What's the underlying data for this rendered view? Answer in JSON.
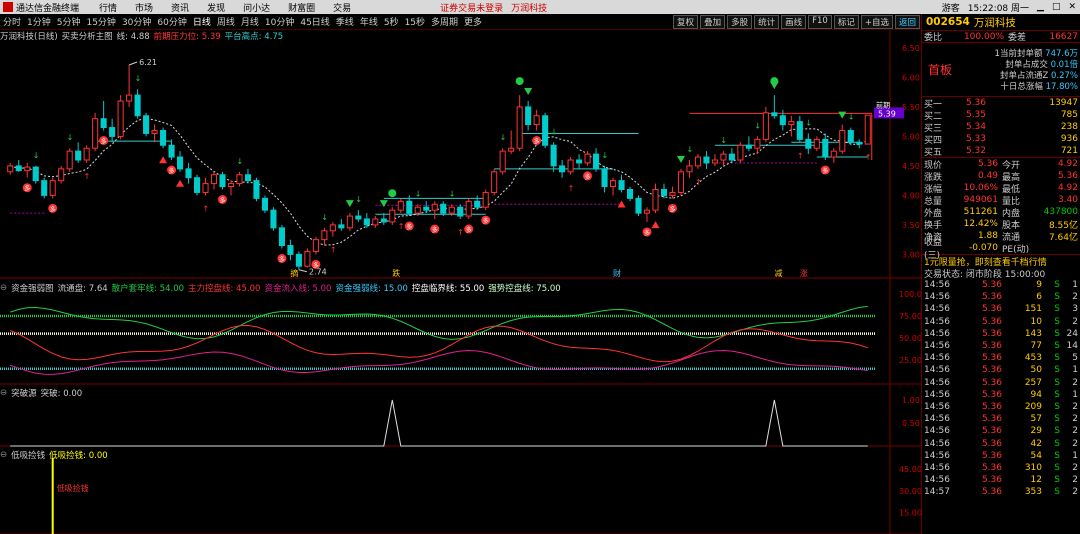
{
  "titlebar": {
    "app": "通达信金融终端",
    "menu": [
      "行情",
      "市场",
      "资讯",
      "发现",
      "问小达",
      "财富圈",
      "交易"
    ],
    "login": "证券交易未登录",
    "stock": "万润科技",
    "time": "15:22:08 周一",
    "misc": [
      "游客"
    ]
  },
  "periods": [
    "分时",
    "1分钟",
    "5分钟",
    "15分钟",
    "30分钟",
    "60分钟",
    "日线",
    "周线",
    "月线",
    "10分钟",
    "45日线",
    "季线",
    "年线",
    "5秒",
    "15秒",
    "多周期",
    "更多"
  ],
  "active_period": "日线",
  "toolbar": [
    "复权",
    "叠加",
    "多股",
    "统计",
    "画线",
    "F10",
    "标记",
    "+自选",
    "返回"
  ],
  "main_header": {
    "name": "万润科技(日线)",
    "formula": "买卖分析主图",
    "params": "线: 4.88",
    "resist_label": "前期压力位: 5.39",
    "plat_label": "平台高点: 4.75"
  },
  "main_axis": [
    "6.50",
    "6.00",
    "5.50",
    "5.00",
    "4.50",
    "4.00",
    "3.50",
    "3.00"
  ],
  "price_tag": "5.39",
  "price_tag_suffix": "前期",
  "annot": {
    "high": "6.21",
    "low": "2.74"
  },
  "event_labels": [
    "摘",
    "跌",
    "财",
    "减",
    "涨"
  ],
  "ind1_header": {
    "name": "资金强弱图",
    "items": [
      "流通盘: 7.64",
      "散户套牢线: 54.00",
      "主力控盘线: 45.00",
      "资金流入线: 5.00",
      "资金强弱线: 15.00",
      "控盘临界线: 55.00",
      "强势控盘线: 75.00"
    ]
  },
  "ind1_axis": [
    "100.0",
    "75.00",
    "50.00",
    "25.00"
  ],
  "ind2_header": {
    "name": "突破源",
    "items": [
      "突破: 0.00"
    ]
  },
  "ind2_axis": [
    "1.00",
    "0.50"
  ],
  "ind3_header": {
    "name": "低吸捡钱",
    "items": [
      "低吸捡钱: 0.00"
    ]
  },
  "ind3_axis": [
    "45.00",
    "30.00",
    "15.00"
  ],
  "ind3_label": "低吸捡钱",
  "quote": {
    "code": "002654",
    "name": "万润科技",
    "weibi_l": "委比",
    "weibi": "100.00%",
    "weicha_l": "委差",
    "weicha": "16627",
    "seal": [
      [
        "1当前封单额",
        "747.6万"
      ],
      [
        "封单占成交",
        "0.01倍"
      ],
      [
        "封单占流通Z",
        "0.27%"
      ],
      [
        "十日总涨幅",
        "17.80%"
      ]
    ],
    "board": "首板",
    "sell": [
      [
        "卖五",
        "5.40",
        ""
      ],
      [
        "卖四",
        "5.39",
        ""
      ],
      [
        "卖三",
        "5.38",
        ""
      ],
      [
        "卖二",
        "5.37",
        ""
      ],
      [
        "卖一",
        "5.36",
        ""
      ]
    ],
    "buy": [
      [
        "买一",
        "5.36",
        "13947"
      ],
      [
        "买二",
        "5.35",
        "785"
      ],
      [
        "买三",
        "5.34",
        "238"
      ],
      [
        "买四",
        "5.33",
        "936"
      ],
      [
        "买五",
        "5.32",
        "721"
      ]
    ],
    "stats": [
      [
        "现价",
        "5.36",
        "今开",
        "4.92"
      ],
      [
        "涨跌",
        "0.49",
        "最高",
        "5.36"
      ],
      [
        "涨幅",
        "10.06%",
        "最低",
        "4.92"
      ],
      [
        "总量",
        "949061",
        "量比",
        "3.40"
      ],
      [
        "外盘",
        "511261",
        "内盘",
        "437800"
      ],
      [
        "换手",
        "12.42%",
        "股本",
        "8.55亿"
      ],
      [
        "净资",
        "1.88",
        "流通",
        "7.64亿"
      ],
      [
        "收益(三)",
        "-0.070",
        "PE(动)",
        ""
      ]
    ],
    "promo": "1元限量抢，即刻查看千档行情",
    "status": "交易状态: 闭市阶段 15:00:00",
    "ticks": [
      [
        "14:56",
        "5.36",
        "9",
        "S",
        "1"
      ],
      [
        "14:56",
        "5.36",
        "6",
        "S",
        "2"
      ],
      [
        "14:56",
        "5.36",
        "151",
        "S",
        "3"
      ],
      [
        "14:56",
        "5.36",
        "10",
        "S",
        "2"
      ],
      [
        "14:56",
        "5.36",
        "143",
        "S",
        "24"
      ],
      [
        "14:56",
        "5.36",
        "77",
        "S",
        "14"
      ],
      [
        "14:56",
        "5.36",
        "453",
        "S",
        "5"
      ],
      [
        "14:56",
        "5.36",
        "50",
        "S",
        "1"
      ],
      [
        "14:56",
        "5.36",
        "257",
        "S",
        "2"
      ],
      [
        "14:56",
        "5.36",
        "94",
        "S",
        "1"
      ],
      [
        "14:56",
        "5.36",
        "209",
        "S",
        "2"
      ],
      [
        "14:56",
        "5.36",
        "57",
        "S",
        "2"
      ],
      [
        "14:56",
        "5.36",
        "29",
        "S",
        "2"
      ],
      [
        "14:56",
        "5.36",
        "42",
        "S",
        "2"
      ],
      [
        "14:56",
        "5.36",
        "54",
        "S",
        "1"
      ],
      [
        "14:56",
        "5.36",
        "310",
        "S",
        "2"
      ],
      [
        "14:56",
        "5.36",
        "12",
        "S",
        "2"
      ],
      [
        "14:57",
        "5.36",
        "353",
        "S",
        "2"
      ]
    ]
  },
  "colors": {
    "up": "#ff3333",
    "down": "#00cccc",
    "wave": "#dddddd",
    "resist": "#ff3333",
    "plat": "#33cccc",
    "green": "#22cc44",
    "magenta": "#e0208f",
    "yellow": "#ffff00"
  },
  "chart_data": {
    "type": "candlestick",
    "price_range": [
      2.6,
      6.6
    ],
    "candles": [
      [
        4.4,
        4.55,
        4.35,
        4.5
      ],
      [
        4.5,
        4.6,
        4.4,
        4.42
      ],
      [
        4.42,
        4.55,
        4.3,
        4.48
      ],
      [
        4.48,
        4.5,
        4.2,
        4.25
      ],
      [
        4.25,
        4.3,
        3.95,
        4.0
      ],
      [
        4.0,
        4.3,
        3.95,
        4.25
      ],
      [
        4.25,
        4.5,
        4.2,
        4.45
      ],
      [
        4.45,
        4.8,
        4.4,
        4.75
      ],
      [
        4.75,
        4.9,
        4.55,
        4.6
      ],
      [
        4.6,
        4.85,
        4.55,
        4.8
      ],
      [
        4.8,
        5.4,
        4.75,
        5.3
      ],
      [
        5.3,
        5.6,
        5.1,
        5.15
      ],
      [
        5.15,
        5.3,
        4.9,
        5.0
      ],
      [
        5.0,
        5.7,
        4.95,
        5.6
      ],
      [
        5.6,
        6.21,
        5.5,
        5.7
      ],
      [
        5.7,
        5.8,
        5.3,
        5.35
      ],
      [
        5.35,
        5.4,
        5.0,
        5.05
      ],
      [
        5.05,
        5.2,
        4.9,
        5.1
      ],
      [
        5.1,
        5.15,
        4.8,
        4.85
      ],
      [
        4.85,
        4.95,
        4.6,
        4.65
      ],
      [
        4.65,
        4.75,
        4.4,
        4.45
      ],
      [
        4.45,
        4.55,
        4.2,
        4.3
      ],
      [
        4.3,
        4.35,
        4.0,
        4.05
      ],
      [
        4.05,
        4.3,
        4.0,
        4.2
      ],
      [
        4.2,
        4.4,
        4.1,
        4.35
      ],
      [
        4.35,
        4.4,
        4.1,
        4.15
      ],
      [
        4.15,
        4.25,
        4.0,
        4.2
      ],
      [
        4.2,
        4.4,
        4.15,
        4.35
      ],
      [
        4.35,
        4.45,
        4.2,
        4.25
      ],
      [
        4.25,
        4.3,
        3.9,
        3.95
      ],
      [
        3.95,
        4.0,
        3.7,
        3.75
      ],
      [
        3.75,
        3.8,
        3.4,
        3.45
      ],
      [
        3.45,
        3.5,
        3.1,
        3.15
      ],
      [
        3.15,
        3.25,
        2.9,
        3.0
      ],
      [
        3.0,
        3.05,
        2.74,
        2.8
      ],
      [
        2.8,
        3.1,
        2.78,
        3.05
      ],
      [
        3.05,
        3.3,
        3.0,
        3.25
      ],
      [
        3.25,
        3.45,
        3.15,
        3.4
      ],
      [
        3.4,
        3.55,
        3.3,
        3.5
      ],
      [
        3.5,
        3.6,
        3.4,
        3.45
      ],
      [
        3.45,
        3.7,
        3.4,
        3.65
      ],
      [
        3.65,
        3.75,
        3.55,
        3.6
      ],
      [
        3.6,
        3.7,
        3.45,
        3.5
      ],
      [
        3.5,
        3.65,
        3.45,
        3.6
      ],
      [
        3.6,
        3.7,
        3.5,
        3.55
      ],
      [
        3.55,
        3.8,
        3.5,
        3.75
      ],
      [
        3.75,
        3.95,
        3.7,
        3.9
      ],
      [
        3.9,
        4.0,
        3.65,
        3.7
      ],
      [
        3.7,
        3.85,
        3.65,
        3.8
      ],
      [
        3.8,
        3.9,
        3.7,
        3.75
      ],
      [
        3.75,
        3.9,
        3.6,
        3.85
      ],
      [
        3.85,
        3.9,
        3.65,
        3.7
      ],
      [
        3.7,
        3.85,
        3.65,
        3.8
      ],
      [
        3.8,
        3.85,
        3.6,
        3.65
      ],
      [
        3.65,
        3.95,
        3.6,
        3.9
      ],
      [
        3.9,
        4.0,
        3.75,
        3.8
      ],
      [
        3.8,
        4.1,
        3.75,
        4.05
      ],
      [
        4.05,
        4.45,
        4.0,
        4.4
      ],
      [
        4.4,
        4.8,
        4.35,
        4.75
      ],
      [
        4.75,
        5.1,
        4.7,
        4.8
      ],
      [
        4.8,
        5.7,
        4.75,
        5.5
      ],
      [
        5.5,
        5.6,
        5.1,
        5.2
      ],
      [
        5.2,
        5.45,
        5.1,
        5.35
      ],
      [
        5.35,
        5.4,
        4.8,
        4.85
      ],
      [
        4.85,
        4.9,
        4.4,
        4.5
      ],
      [
        4.5,
        4.6,
        4.3,
        4.4
      ],
      [
        4.4,
        4.65,
        4.35,
        4.6
      ],
      [
        4.6,
        4.7,
        4.45,
        4.55
      ],
      [
        4.55,
        4.75,
        4.5,
        4.7
      ],
      [
        4.7,
        4.8,
        4.4,
        4.45
      ],
      [
        4.45,
        4.5,
        4.05,
        4.15
      ],
      [
        4.15,
        4.3,
        4.0,
        4.25
      ],
      [
        4.25,
        4.35,
        4.05,
        4.1
      ],
      [
        4.1,
        4.15,
        3.9,
        3.95
      ],
      [
        3.95,
        4.0,
        3.65,
        3.7
      ],
      [
        3.7,
        3.8,
        3.55,
        3.75
      ],
      [
        3.75,
        4.2,
        3.7,
        4.1
      ],
      [
        4.1,
        4.2,
        3.95,
        4.0
      ],
      [
        4.0,
        4.15,
        3.95,
        4.05
      ],
      [
        4.05,
        4.45,
        4.0,
        4.4
      ],
      [
        4.4,
        4.6,
        4.3,
        4.5
      ],
      [
        4.5,
        4.7,
        4.45,
        4.65
      ],
      [
        4.65,
        4.75,
        4.45,
        4.55
      ],
      [
        4.55,
        4.7,
        4.5,
        4.6
      ],
      [
        4.6,
        4.75,
        4.5,
        4.7
      ],
      [
        4.7,
        4.8,
        4.55,
        4.6
      ],
      [
        4.6,
        4.9,
        4.55,
        4.85
      ],
      [
        4.85,
        5.0,
        4.75,
        4.8
      ],
      [
        4.8,
        5.0,
        4.7,
        4.95
      ],
      [
        4.95,
        5.5,
        4.9,
        5.4
      ],
      [
        5.4,
        5.7,
        5.3,
        5.35
      ],
      [
        5.35,
        5.45,
        5.1,
        5.2
      ],
      [
        5.2,
        5.35,
        5.0,
        5.25
      ],
      [
        5.25,
        5.35,
        4.9,
        4.95
      ],
      [
        4.95,
        5.05,
        4.7,
        4.8
      ],
      [
        4.8,
        5.0,
        4.75,
        4.95
      ],
      [
        4.95,
        5.05,
        4.6,
        4.65
      ],
      [
        4.65,
        4.8,
        4.55,
        4.75
      ],
      [
        4.75,
        5.2,
        4.7,
        5.1
      ],
      [
        5.1,
        5.15,
        4.85,
        4.9
      ],
      [
        4.9,
        4.95,
        4.8,
        4.87
      ],
      [
        4.87,
        5.36,
        4.87,
        5.36
      ]
    ]
  }
}
